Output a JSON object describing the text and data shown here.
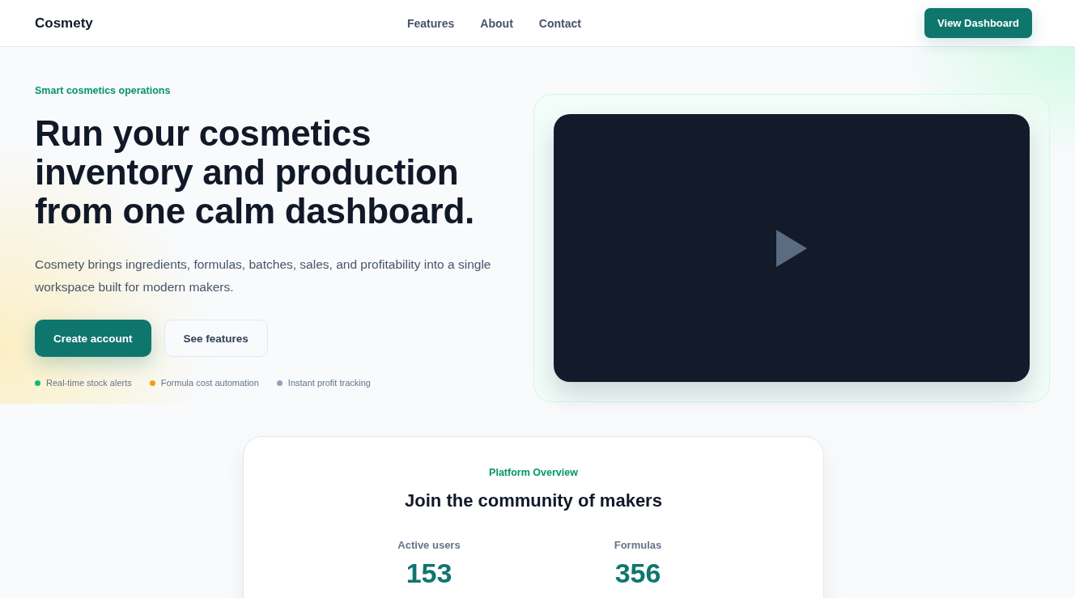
{
  "header": {
    "logo": "Cosmety",
    "nav": [
      {
        "label": "Features"
      },
      {
        "label": "About"
      },
      {
        "label": "Contact"
      }
    ],
    "cta": "View Dashboard"
  },
  "hero": {
    "eyebrow": "Smart cosmetics operations",
    "title": "Run your cosmetics inventory and production from one calm dashboard.",
    "description": "Cosmety brings ingredients, formulas, batches, sales, and profitability into a single workspace built for modern makers.",
    "buttons": [
      {
        "label": "Create account",
        "kind": "primary"
      },
      {
        "label": "See features",
        "kind": "secondary"
      }
    ],
    "highlights": [
      {
        "label": "Real-time stock alerts",
        "color": "#10b981"
      },
      {
        "label": "Formula cost automation",
        "color": "#f59e0b"
      },
      {
        "label": "Instant profit tracking",
        "color": "#94a3b8"
      }
    ],
    "video": {
      "kind": "video"
    }
  },
  "overview": {
    "eyebrow": "Platform Overview",
    "title": "Join the community of makers",
    "stats": [
      {
        "label": "Active users",
        "value": "153"
      },
      {
        "label": "Formulas",
        "value": "356"
      }
    ]
  }
}
